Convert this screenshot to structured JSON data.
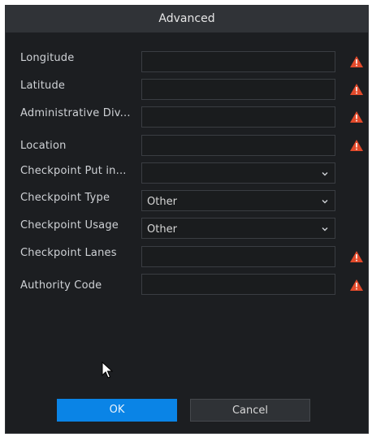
{
  "dialog": {
    "title": "Advanced"
  },
  "fields": {
    "longitude": {
      "label": "Longitude",
      "value": ""
    },
    "latitude": {
      "label": "Latitude",
      "value": ""
    },
    "admin_div": {
      "label": "Administrative Div...",
      "value": ""
    },
    "location": {
      "label": "Location",
      "value": ""
    },
    "checkpoint_put_in": {
      "label": "Checkpoint Put in...",
      "selected": ""
    },
    "checkpoint_type": {
      "label": "Checkpoint Type",
      "selected": "Other"
    },
    "checkpoint_usage": {
      "label": "Checkpoint Usage",
      "selected": "Other"
    },
    "checkpoint_lanes": {
      "label": "Checkpoint Lanes",
      "value": ""
    },
    "authority_code": {
      "label": "Authority Code",
      "value": ""
    }
  },
  "buttons": {
    "ok": "OK",
    "cancel": "Cancel"
  },
  "icons": {
    "required": "warning-icon",
    "dropdown": "chevron-down-icon",
    "pointer": "mouse-cursor-icon"
  },
  "colors": {
    "primary": "#0a84e6",
    "warning": "#e24a2b",
    "background": "#1c1e21",
    "titlebar": "#303337"
  }
}
